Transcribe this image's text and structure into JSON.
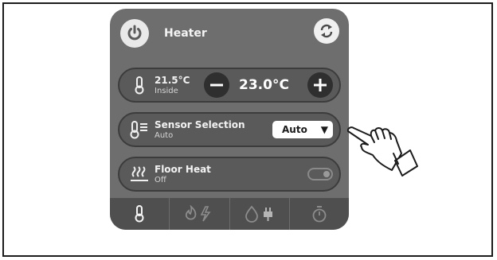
{
  "header": {
    "title": "Heater"
  },
  "temperature": {
    "inside_value": "21.5°C",
    "inside_label": "Inside",
    "setpoint": "23.0°C"
  },
  "sensor": {
    "label": "Sensor Selection",
    "sub": "Auto",
    "selected": "Auto"
  },
  "floor_heat": {
    "label": "Floor Heat",
    "state": "Off"
  },
  "tabs": [
    {
      "icon": "thermometer-icon"
    },
    {
      "icon": "flame-lightning-icon"
    },
    {
      "icon": "drop-plug-icon"
    },
    {
      "icon": "timer-icon"
    }
  ],
  "colors": {
    "card": "#6e6e6e",
    "row": "#5a5a5a",
    "tabs": "#4f4f4f"
  }
}
